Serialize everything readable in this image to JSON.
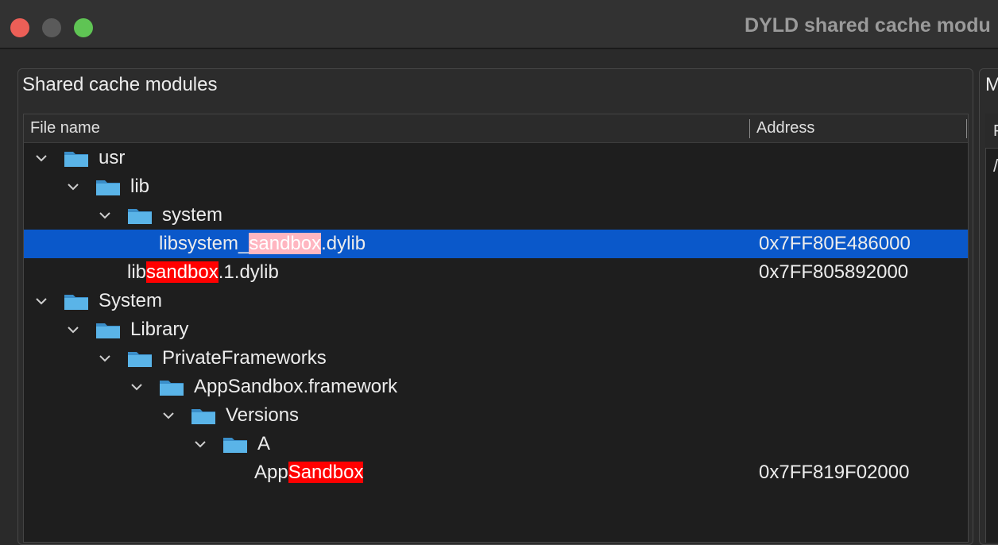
{
  "window": {
    "title": "DYLD shared cache modu"
  },
  "left_panel": {
    "title": "Shared cache modules",
    "columns": {
      "file_name": "File name",
      "address": "Address"
    },
    "rows": [
      {
        "label": "usr",
        "address": ""
      },
      {
        "label": "lib",
        "address": ""
      },
      {
        "label": "system",
        "address": ""
      },
      {
        "pre": "libsystem_",
        "match": "sandbox",
        "post": ".dylib",
        "address": "0x7FF80E486000",
        "selected": true
      },
      {
        "pre": "lib",
        "match": "sandbox",
        "post": ".1.dylib",
        "address": "0x7FF805892000"
      },
      {
        "label": "System",
        "address": ""
      },
      {
        "label": "Library",
        "address": ""
      },
      {
        "label": "PrivateFrameworks",
        "address": ""
      },
      {
        "label": "AppSandbox.framework",
        "address": ""
      },
      {
        "label": "Versions",
        "address": ""
      },
      {
        "label": "A",
        "address": ""
      },
      {
        "pre": "App",
        "match": "Sandbox",
        "post": "",
        "address": "0x7FF819F02000"
      }
    ]
  },
  "right_panel": {
    "title_partial": "M",
    "header_partial": "F",
    "row_partial": "/"
  },
  "colors": {
    "selection": "#0a58ca",
    "match_highlight": "#ff0000",
    "selected_match_highlight": "#ffb6c1",
    "folder": "#5ab4e8"
  },
  "icons": [
    "chevron-down-icon",
    "folder-icon"
  ]
}
